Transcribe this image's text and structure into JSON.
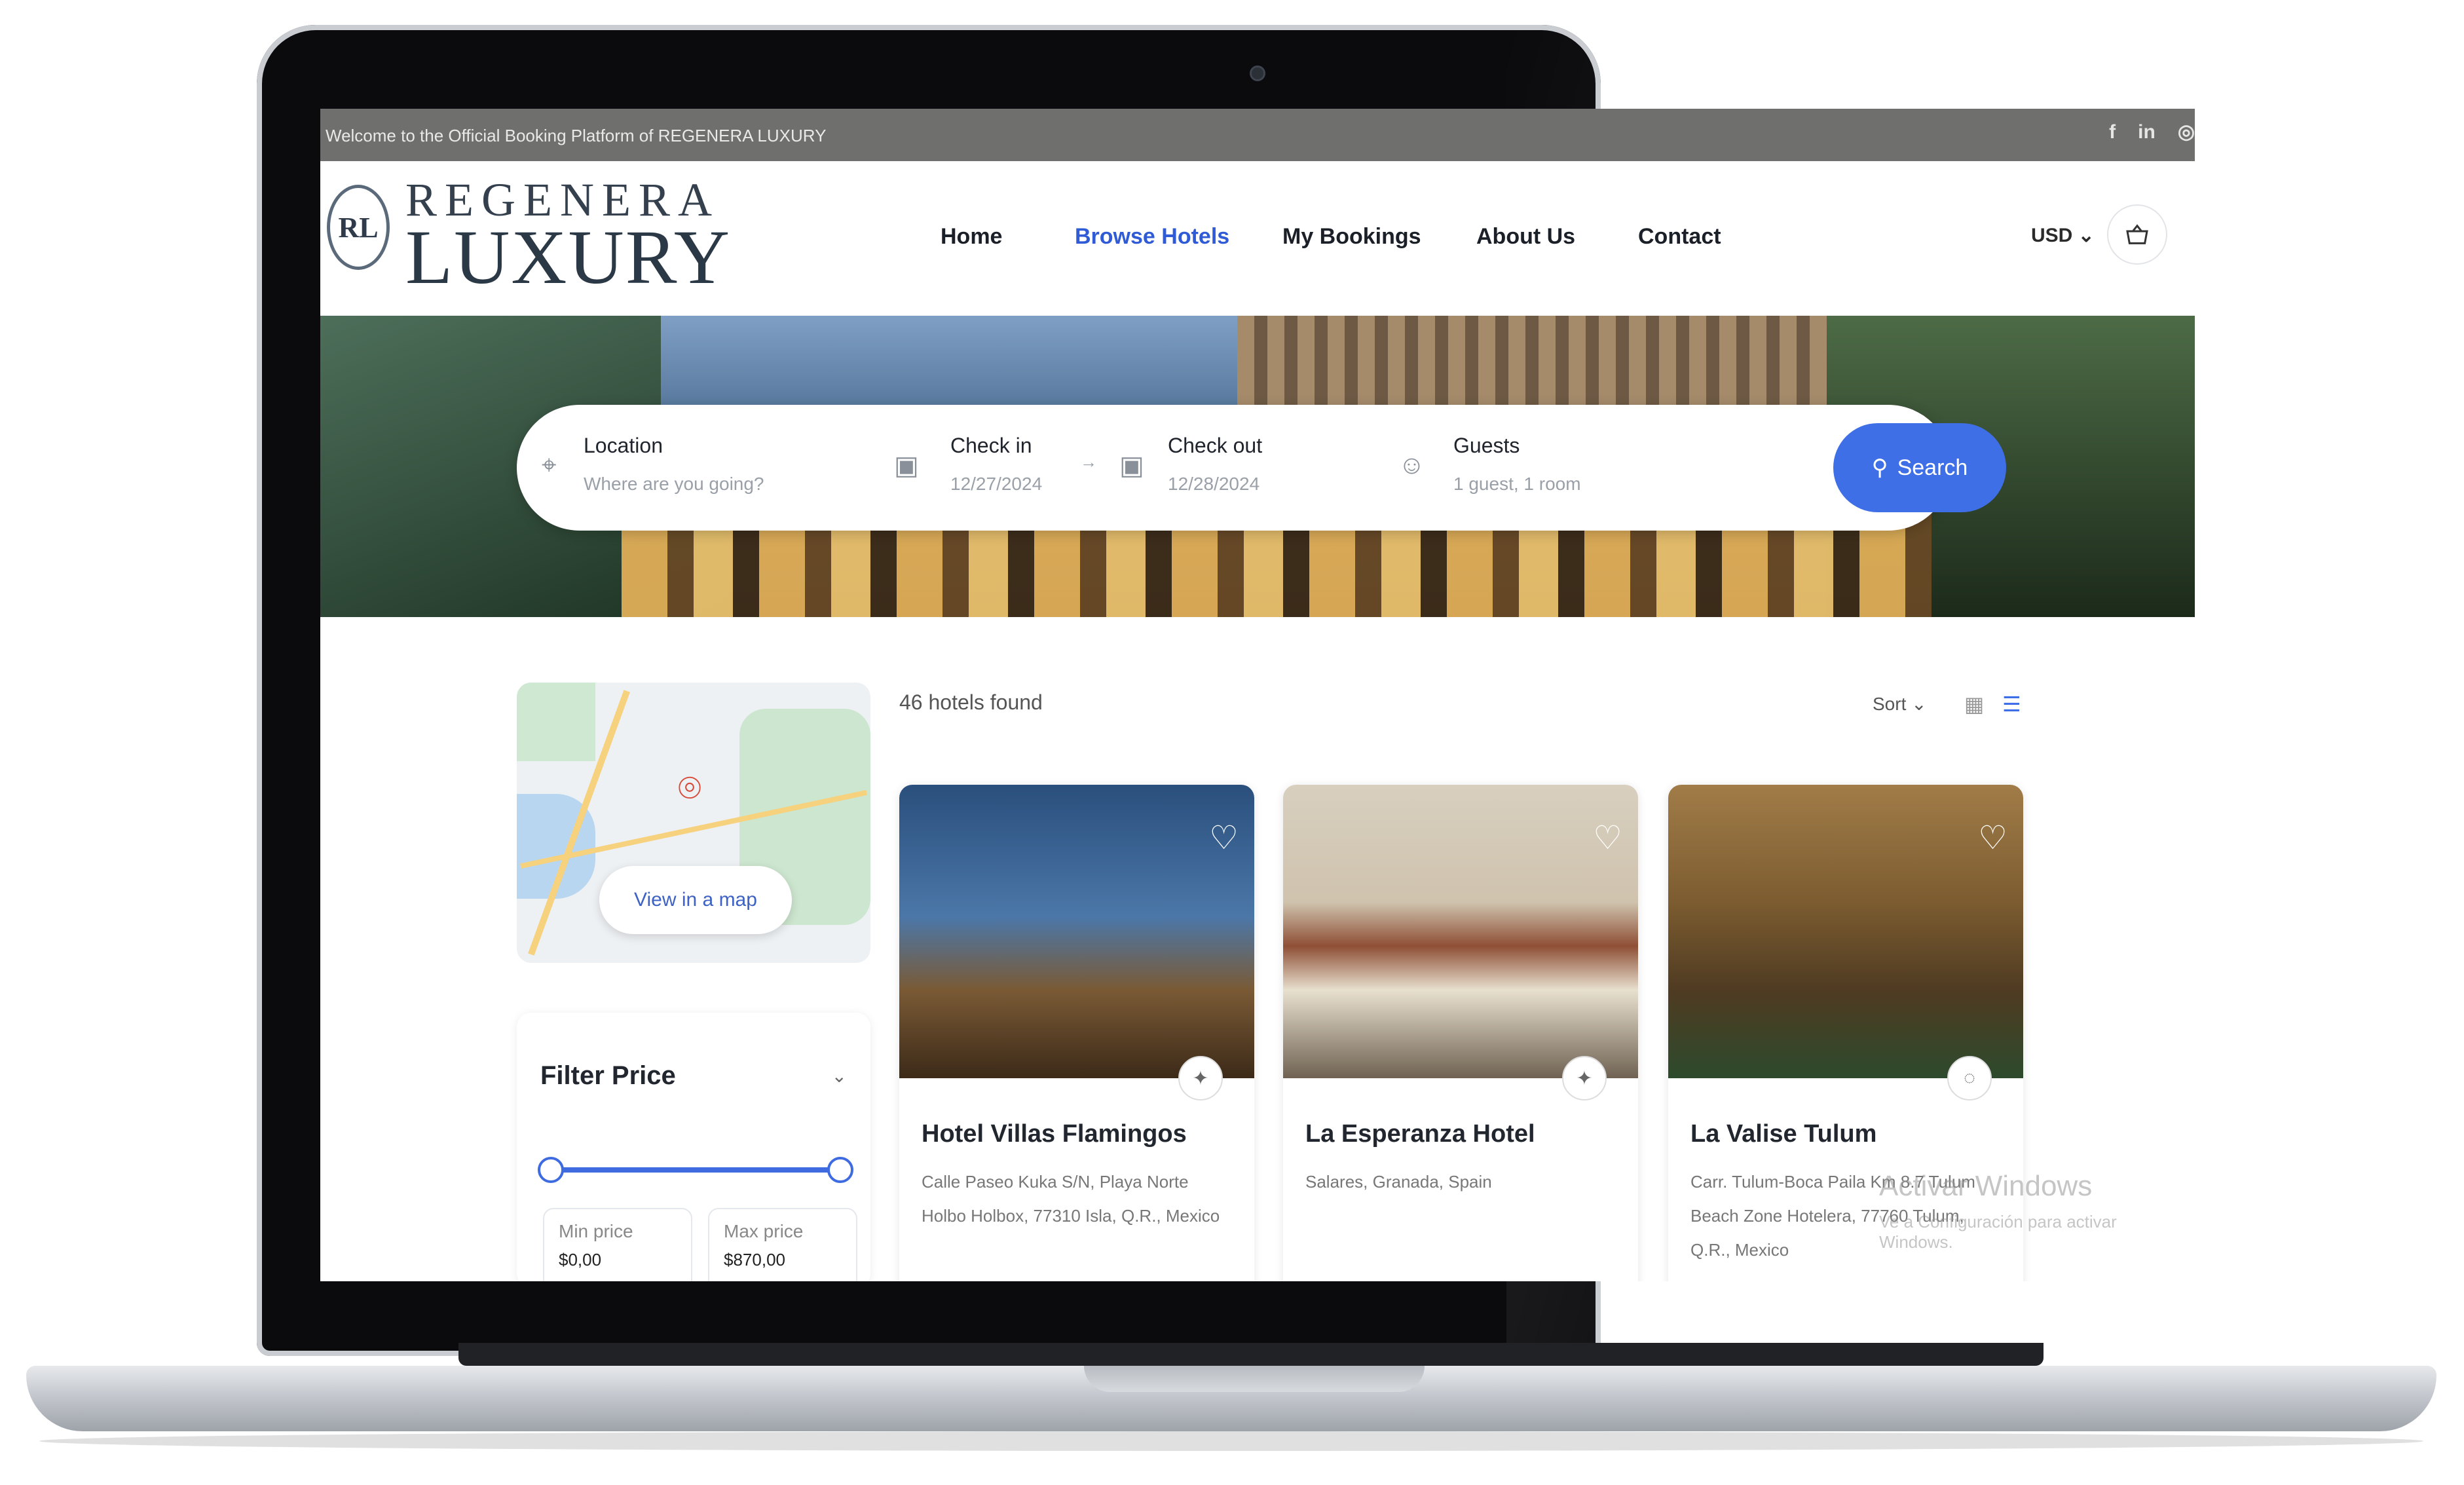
{
  "topbar": {
    "welcome": "Welcome to the Official Booking Platform of REGENERA LUXURY",
    "social": [
      "f",
      "in",
      "◎"
    ]
  },
  "logo": {
    "emblem": "RL",
    "top": "REGENERA",
    "bottom": "LUXURY"
  },
  "nav": {
    "home": "Home",
    "browse": "Browse Hotels",
    "bookings": "My Bookings",
    "about": "About Us",
    "contact": "Contact"
  },
  "header": {
    "currency": "USD ⌄",
    "cart_icon": "basket-icon"
  },
  "search": {
    "location_label": "Location",
    "location_placeholder": "Where are you going?",
    "checkin_label": "Check in",
    "checkin_value": "12/27/2024",
    "checkout_label": "Check out",
    "checkout_value": "12/28/2024",
    "guests_label": "Guests",
    "guests_value": "1 guest, 1 room",
    "button": "Search"
  },
  "map": {
    "button": "View in a map"
  },
  "filter": {
    "title": "Filter Price",
    "min_label": "Min price",
    "min_value": "$0,00",
    "max_label": "Max price",
    "max_value": "$870,00"
  },
  "results": {
    "count": "46 hotels found",
    "sort": "Sort ⌄"
  },
  "hotels": [
    {
      "name": "Hotel Villas Flamingos",
      "address": "Calle Paseo Kuka S/N, Playa Norte Holbo Holbox, 77310 Isla, Q.R., Mexico"
    },
    {
      "name": "La Esperanza Hotel",
      "address": "Salares, Granada, Spain"
    },
    {
      "name": "La Valise Tulum",
      "address": "Carr. Tulum-Boca Paila Km 8.7 Tulum Beach Zone Hotelera, 77760 Tulum, Q.R., Mexico"
    }
  ],
  "watermark": {
    "line1": "Activar Windows",
    "line2": "Ve a Configuración para activar Windows."
  }
}
